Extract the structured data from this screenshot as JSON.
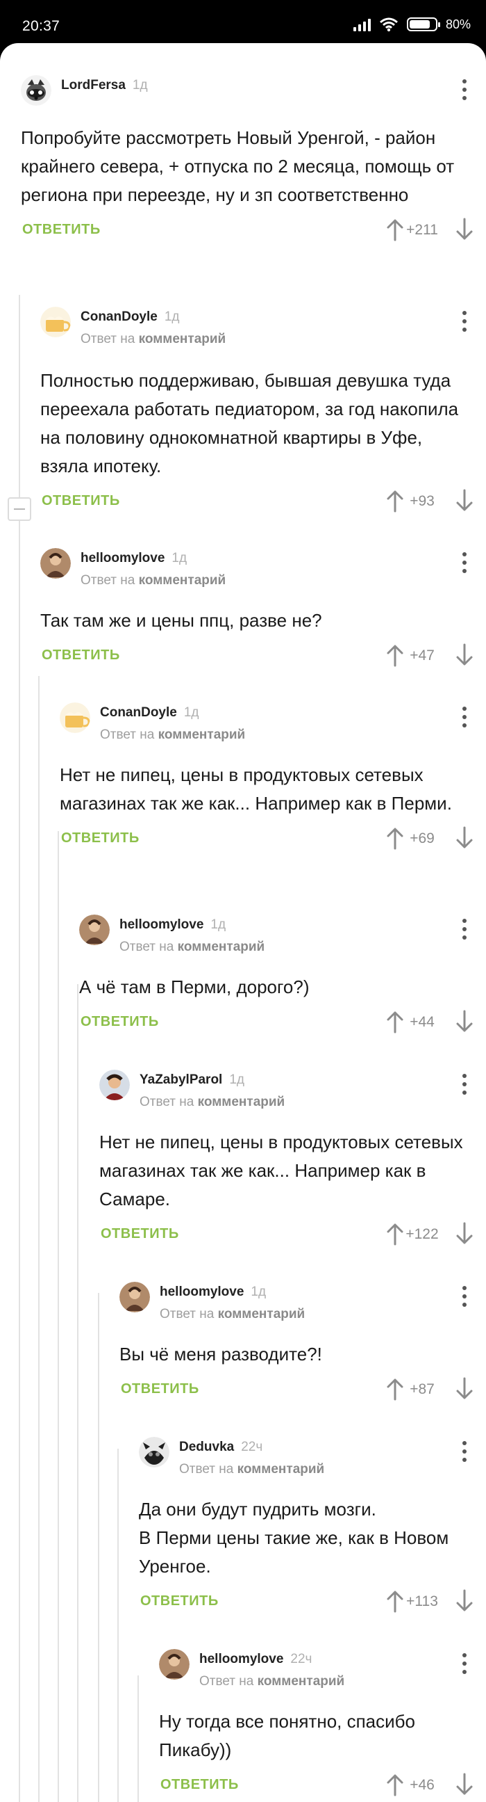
{
  "status_bar": {
    "time": "20:37",
    "battery": "80",
    "battery_level": 0.8
  },
  "labels": {
    "reply_to_prefix": "Ответ на",
    "reply_to_target": "комментарий",
    "reply_button": "ОТВЕТИТЬ"
  },
  "comments": [
    {
      "author": "LordFersa",
      "time": "1д",
      "text": "Попробуйте рассмотреть Новый Уренгой, - район крайнего севера, + отпуска по 2 месяца, помощь от региона при переезде, ну и зп соответственно",
      "rating": "+211"
    },
    {
      "author": "ConanDoyle",
      "time": "1д",
      "text": "Полностью поддерживаю, бывшая девушка туда переехала работать педиатором, за год накопила на половину однокомнатной квартиры в Уфе, взяла ипотеку.",
      "rating": "+93"
    },
    {
      "author": "helloomylove",
      "time": "1д",
      "text": "Так там же и цены ппц, разве не?",
      "rating": "+47"
    },
    {
      "author": "ConanDoyle",
      "time": "1д",
      "text": "Нет не пипец, цены в продуктовых сетевых магазинах так же как... Например как в Перми.",
      "rating": "+69"
    },
    {
      "author": "helloomylove",
      "time": "1д",
      "text": "А чё там в Перми, дорого?)",
      "rating": "+44"
    },
    {
      "author": "YaZabylParol",
      "time": "1д",
      "text": "Нет не пипец, цены в продуктовых сетевых магазинах так же как... Например как в Самаре.",
      "rating": "+122"
    },
    {
      "author": "helloomylove",
      "time": "1д",
      "text": "Вы чё меня разводите?!",
      "rating": "+87"
    },
    {
      "author": "Deduvka",
      "time": "22ч",
      "text": "Да они будут пудрить мозги.\nВ Перми цены такие же, как в Новом Уренгое.",
      "rating": "+113"
    },
    {
      "author": "helloomylove",
      "time": "22ч",
      "text": "Ну тогда все понятно, спасибо Пикабу))",
      "rating": "+46"
    }
  ],
  "colors": {
    "accent_green": "#8cbf4a",
    "muted": "#8b8b8b",
    "thread_line": "#e2e2e2"
  }
}
